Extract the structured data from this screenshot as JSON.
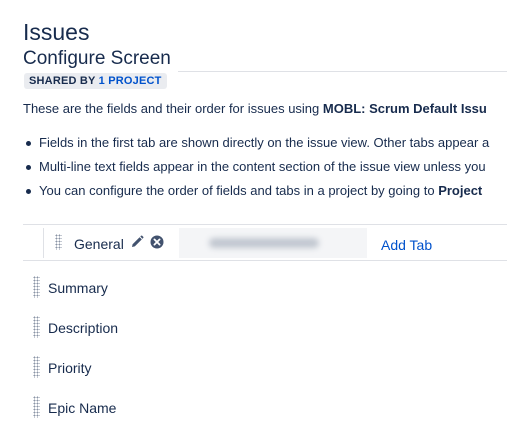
{
  "page": {
    "title": "Issues"
  },
  "section": {
    "title": "Configure Screen",
    "shared_prefix": "SHARED BY",
    "shared_link": "1 PROJECT",
    "intro_prefix": "These are the fields and their order for issues using ",
    "intro_bold": "MOBL: Scrum Default Issu"
  },
  "bullets": [
    {
      "text": "Fields in the first tab are shown directly on the issue view. Other tabs appear a",
      "bold": ""
    },
    {
      "text": "Multi-line text fields appear in the content section of the issue view unless you",
      "bold": ""
    },
    {
      "text": "You can configure the order of fields and tabs in a project by going to ",
      "bold": "Project"
    }
  ],
  "tabs": {
    "general_label": "General",
    "add_tab_label": "Add Tab"
  },
  "fields": [
    {
      "name": "Summary"
    },
    {
      "name": "Description"
    },
    {
      "name": "Priority"
    },
    {
      "name": "Epic Name"
    }
  ],
  "colors": {
    "text": "#172b4d",
    "link": "#0052cc",
    "border": "#dfe1e6",
    "lozenge_bg": "#eaecf0"
  },
  "icons": {
    "edit": "pencil-icon",
    "remove": "close-circle-icon",
    "drag": "drag-handle-icon"
  }
}
